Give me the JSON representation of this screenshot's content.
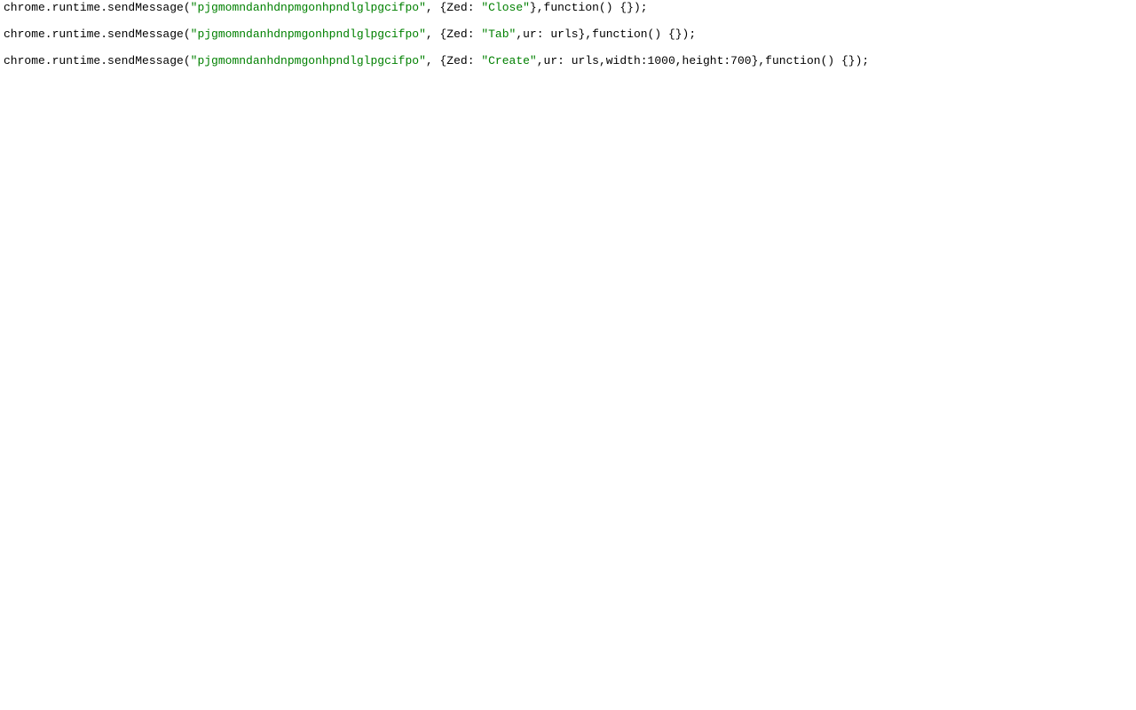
{
  "code": {
    "lines": [
      {
        "tokens": [
          {
            "cls": "tok-plain",
            "text": "chrome.runtime.sendMessage("
          },
          {
            "cls": "tok-string",
            "text": "\"pjgmomndanhdnpmgonhpndlglpgcifpo\""
          },
          {
            "cls": "tok-plain",
            "text": ", {Zed: "
          },
          {
            "cls": "tok-string",
            "text": "\"Close\""
          },
          {
            "cls": "tok-plain",
            "text": "},function() {});"
          }
        ]
      },
      {
        "tokens": [
          {
            "cls": "tok-plain",
            "text": "chrome.runtime.sendMessage("
          },
          {
            "cls": "tok-string",
            "text": "\"pjgmomndanhdnpmgonhpndlglpgcifpo\""
          },
          {
            "cls": "tok-plain",
            "text": ", {Zed: "
          },
          {
            "cls": "tok-string",
            "text": "\"Tab\""
          },
          {
            "cls": "tok-plain",
            "text": ",ur: urls},function() {});"
          }
        ]
      },
      {
        "tokens": [
          {
            "cls": "tok-plain",
            "text": "chrome.runtime.sendMessage("
          },
          {
            "cls": "tok-string",
            "text": "\"pjgmomndanhdnpmgonhpndlglpgcifpo\""
          },
          {
            "cls": "tok-plain",
            "text": ", {Zed: "
          },
          {
            "cls": "tok-string",
            "text": "\"Create\""
          },
          {
            "cls": "tok-plain",
            "text": ",ur: urls,width:1000,height:700},function() {});"
          }
        ]
      }
    ]
  }
}
